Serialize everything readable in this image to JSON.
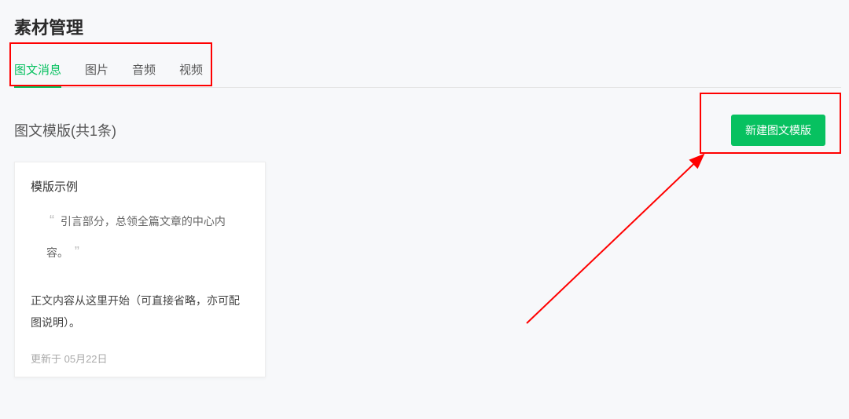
{
  "page": {
    "title": "素材管理"
  },
  "tabs": [
    {
      "label": "图文消息",
      "active": true
    },
    {
      "label": "图片",
      "active": false
    },
    {
      "label": "音频",
      "active": false
    },
    {
      "label": "视频",
      "active": false
    }
  ],
  "section": {
    "title": "图文模版(共1条)",
    "create_button": "新建图文模版"
  },
  "card": {
    "title": "模版示例",
    "quote": "引言部分，总领全篇文章的中心内容。",
    "body": "正文内容从这里开始（可直接省略，亦可配图说明）。",
    "meta": "更新于 05月22日"
  }
}
